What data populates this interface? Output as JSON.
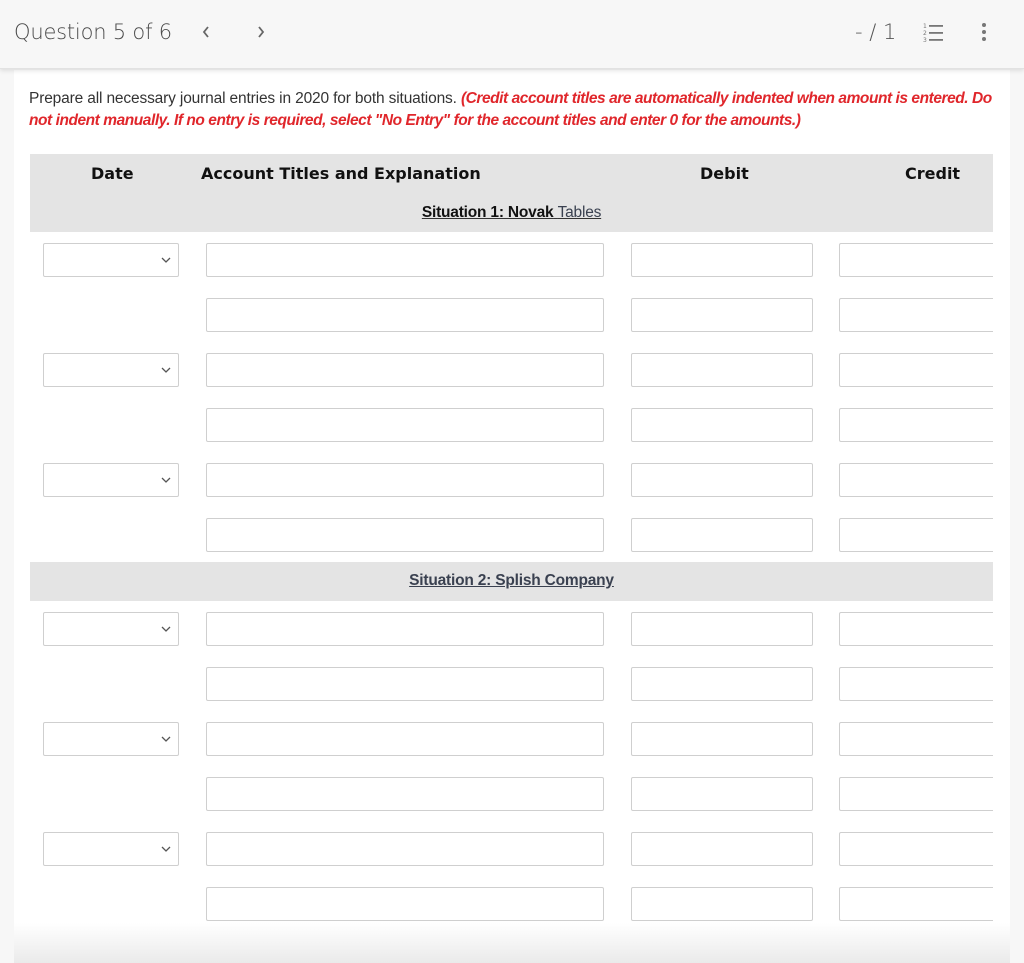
{
  "header": {
    "question_label": "Question 5 of 6",
    "prev_icon": "chevron-left-icon",
    "next_icon": "chevron-right-icon",
    "score": "- / 1",
    "list_icon": "numbered-list-icon",
    "more_icon": "more-vertical-icon"
  },
  "instructions": {
    "text": "Prepare all necessary journal entries in 2020 for both situations. ",
    "warning": "(Credit account titles are automatically indented when amount is entered. Do not indent manually. If no entry is required, select \"No Entry\" for the account titles and enter 0 for the amounts.)"
  },
  "table": {
    "columns": {
      "date": "Date",
      "account": "Account Titles and Explanation",
      "debit": "Debit",
      "credit": "Credit"
    },
    "sections": [
      {
        "title_part1": "Situation 1: Novak",
        "title_part2": "Tables",
        "rows": [
          {
            "has_date": true,
            "date": "",
            "account": "",
            "debit": "",
            "credit": ""
          },
          {
            "has_date": false,
            "account": "",
            "debit": "",
            "credit": ""
          },
          {
            "has_date": true,
            "date": "",
            "account": "",
            "debit": "",
            "credit": ""
          },
          {
            "has_date": false,
            "account": "",
            "debit": "",
            "credit": ""
          },
          {
            "has_date": true,
            "date": "",
            "account": "",
            "debit": "",
            "credit": ""
          },
          {
            "has_date": false,
            "account": "",
            "debit": "",
            "credit": ""
          }
        ]
      },
      {
        "title": "Situation 2: Splish Company",
        "rows": [
          {
            "has_date": true,
            "date": "",
            "account": "",
            "debit": "",
            "credit": ""
          },
          {
            "has_date": false,
            "account": "",
            "debit": "",
            "credit": ""
          },
          {
            "has_date": true,
            "date": "",
            "account": "",
            "debit": "",
            "credit": ""
          },
          {
            "has_date": false,
            "account": "",
            "debit": "",
            "credit": ""
          },
          {
            "has_date": true,
            "date": "",
            "account": "",
            "debit": "",
            "credit": ""
          },
          {
            "has_date": false,
            "account": "",
            "debit": "",
            "credit": ""
          }
        ]
      }
    ]
  },
  "colors": {
    "warning": "#e0262b",
    "header_bg": "#e4e4e4",
    "section_title_slate": "#3a4150"
  }
}
